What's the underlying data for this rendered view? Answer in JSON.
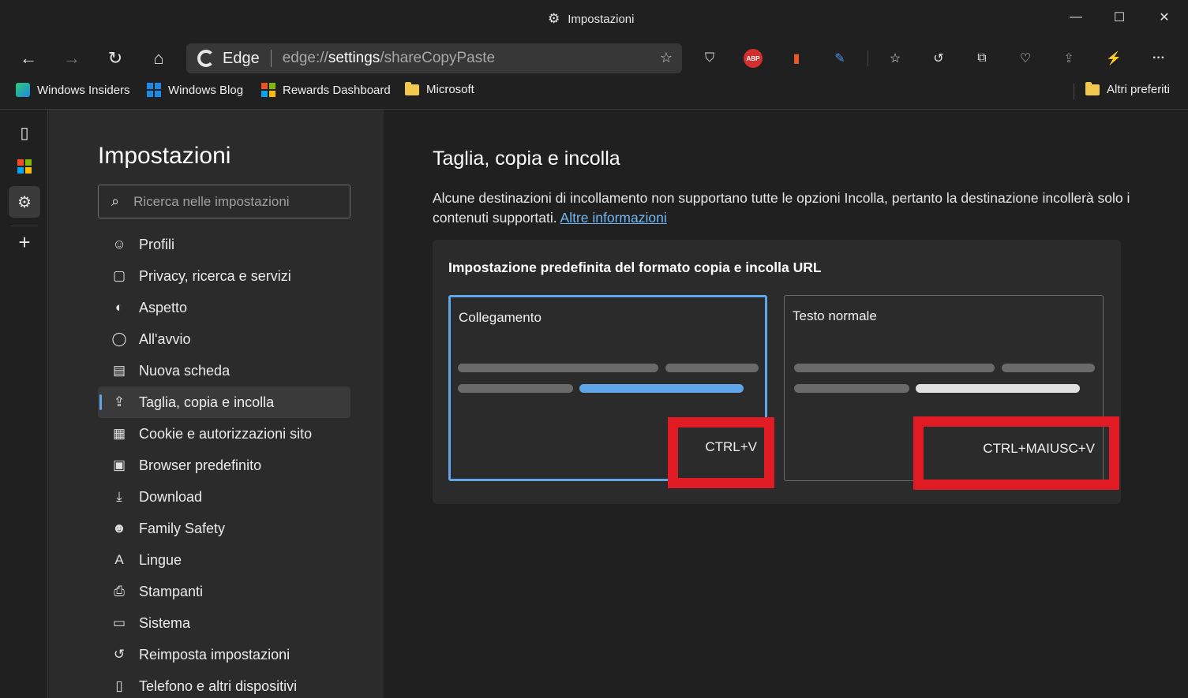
{
  "window": {
    "title": "Impostazioni",
    "minimize_glyph": "—",
    "maximize_glyph": "☐",
    "close_glyph": "✕"
  },
  "toolbar": {
    "back_glyph": "←",
    "forward_glyph": "→",
    "refresh_glyph": "↻",
    "home_glyph": "⌂",
    "address": {
      "brand": "Edge",
      "url_prefix": "edge://",
      "url_bold": "settings",
      "url_suffix": "/shareCopyPaste",
      "favorite_glyph": "☆"
    },
    "extensions": [
      {
        "name": "shield-extension-icon",
        "glyph": "⛉"
      },
      {
        "name": "adblock-plus-extension-icon",
        "glyph": "ABP"
      },
      {
        "name": "office-extension-icon",
        "glyph": "▮"
      },
      {
        "name": "pen-extension-icon",
        "glyph": "✎"
      }
    ],
    "actions": [
      {
        "name": "favorites-icon",
        "glyph": "☆"
      },
      {
        "name": "history-icon",
        "glyph": "↺"
      },
      {
        "name": "collections-icon",
        "glyph": "⧉"
      },
      {
        "name": "browser-essentials-icon",
        "glyph": "♡"
      },
      {
        "name": "share-icon",
        "glyph": "⇪"
      },
      {
        "name": "performance-icon",
        "glyph": "⚡"
      },
      {
        "name": "more-menu-icon",
        "glyph": "···"
      }
    ]
  },
  "favorites_bar": {
    "items": [
      {
        "label": "Windows Insiders",
        "icon": "windows-insiders-icon"
      },
      {
        "label": "Windows Blog",
        "icon": "windows-logo-icon"
      },
      {
        "label": "Rewards Dashboard",
        "icon": "microsoft-logo-icon"
      },
      {
        "label": "Microsoft",
        "icon": "folder-icon"
      }
    ],
    "other_favorites": "Altri preferiti"
  },
  "rail": {
    "tab_actions_glyph": "▯",
    "new_tab_glyph": "+",
    "settings_glyph": "⚙"
  },
  "settings_nav": {
    "title": "Impostazioni",
    "search_placeholder": "Ricerca nelle impostazioni",
    "items": [
      {
        "label": "Profili",
        "icon": "profile-icon",
        "glyph": "☺"
      },
      {
        "label": "Privacy, ricerca e servizi",
        "icon": "lock-icon",
        "glyph": "🔒"
      },
      {
        "label": "Aspetto",
        "icon": "palette-icon",
        "glyph": "◐"
      },
      {
        "label": "All'avvio",
        "icon": "power-icon",
        "glyph": "⏻"
      },
      {
        "label": "Nuova scheda",
        "icon": "new-tab-icon",
        "glyph": "▤"
      },
      {
        "label": "Taglia, copia e incolla",
        "icon": "share-icon",
        "glyph": "⇪",
        "active": true
      },
      {
        "label": "Cookie e autorizzazioni sito",
        "icon": "site-permissions-icon",
        "glyph": "▦"
      },
      {
        "label": "Browser predefinito",
        "icon": "default-browser-icon",
        "glyph": "▣"
      },
      {
        "label": "Download",
        "icon": "download-icon",
        "glyph": "⤓"
      },
      {
        "label": "Family Safety",
        "icon": "family-icon",
        "glyph": "☻"
      },
      {
        "label": "Lingue",
        "icon": "language-icon",
        "glyph": "A"
      },
      {
        "label": "Stampanti",
        "icon": "printer-icon",
        "glyph": "⎙"
      },
      {
        "label": "Sistema",
        "icon": "laptop-icon",
        "glyph": "▭"
      },
      {
        "label": "Reimposta impostazioni",
        "icon": "reset-icon",
        "glyph": "↺"
      },
      {
        "label": "Telefono e altri dispositivi",
        "icon": "phone-icon",
        "glyph": "▯"
      }
    ]
  },
  "main": {
    "title": "Taglia, copia e incolla",
    "description": "Alcune destinazioni di incollamento non supportano tutte le opzioni Incolla, pertanto la destinazione incollerà solo i contenuti supportati.",
    "learn_more": "Altre informazioni",
    "card_heading": "Impostazione predefinita del formato copia e incolla URL",
    "options": [
      {
        "label": "Collegamento",
        "shortcut": "CTRL+V",
        "selected": true
      },
      {
        "label": "Testo normale",
        "shortcut": "CTRL+MAIUSC+V",
        "selected": false
      }
    ]
  },
  "colors": {
    "accent": "#60a5e8",
    "highlight": "#e01b24",
    "link": "#6fb8f5"
  }
}
